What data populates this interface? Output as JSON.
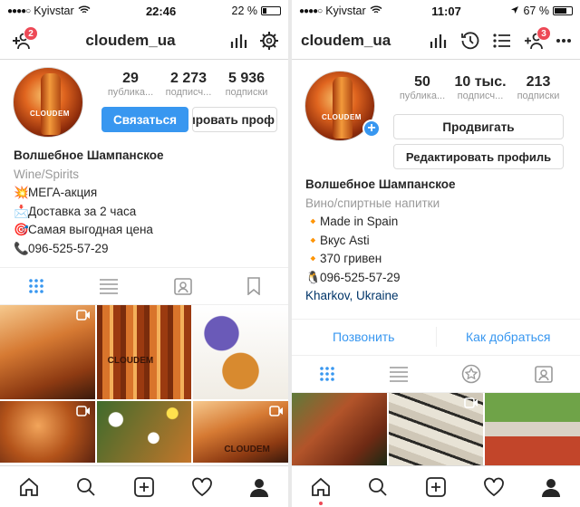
{
  "left": {
    "status": {
      "carrier": "Kyivstar",
      "time": "22:46",
      "battery": "22 %",
      "battery_level": 0.22
    },
    "nav": {
      "title": "cloudem_ua",
      "badge": "2"
    },
    "avatar_text": "CLOUDEM",
    "stats": [
      {
        "value": "29",
        "label": "публика..."
      },
      {
        "value": "2 273",
        "label": "подписч..."
      },
      {
        "value": "5 936",
        "label": "подписки"
      }
    ],
    "buttons": {
      "contact": "Связаться",
      "edit": "ктировать проф"
    },
    "bio": {
      "name": "Волшебное Шампанское",
      "category": "Wine/Spirits",
      "lines": [
        {
          "icon": "💥",
          "text": "МЕГА-акция"
        },
        {
          "icon": "📩",
          "text": "Доставка за 2 часа"
        },
        {
          "icon": "🎯",
          "text": "Самая выгодная цена"
        },
        {
          "icon": "📞",
          "text": "096-525-57-29"
        }
      ]
    },
    "grid_text": {
      "cloudem": "CLOUDEM",
      "cloudem_short": "CLOUDEM"
    }
  },
  "right": {
    "status": {
      "carrier": "Kyivstar",
      "time": "11:07",
      "battery": "67 %",
      "battery_level": 0.67
    },
    "nav": {
      "title": "cloudem_ua",
      "badge": "3"
    },
    "avatar_text": "CLOUDEM",
    "stats": [
      {
        "value": "50",
        "label": "публика..."
      },
      {
        "value": "10 тыс.",
        "label": "подписч..."
      },
      {
        "value": "213",
        "label": "подписки"
      }
    ],
    "buttons": {
      "promote": "Продвигать",
      "edit": "Редактировать профиль"
    },
    "bio": {
      "name": "Волшебное Шампанское",
      "category": "Вино/спиртные напитки",
      "lines": [
        {
          "icon": "🔸",
          "text": "Made in Spain"
        },
        {
          "icon": "🔸",
          "text": "Вкус Asti"
        },
        {
          "icon": "🔸",
          "text": "370 гривен"
        },
        {
          "icon": "🐧",
          "text": "096-525-57-29"
        }
      ],
      "location": "Kharkov, Ukraine"
    },
    "contact": {
      "call": "Позвонить",
      "directions": "Как добраться"
    }
  },
  "colors": {
    "accent": "#3897f0",
    "badge": "#ed4956",
    "text": "#262626",
    "muted": "#999999"
  }
}
